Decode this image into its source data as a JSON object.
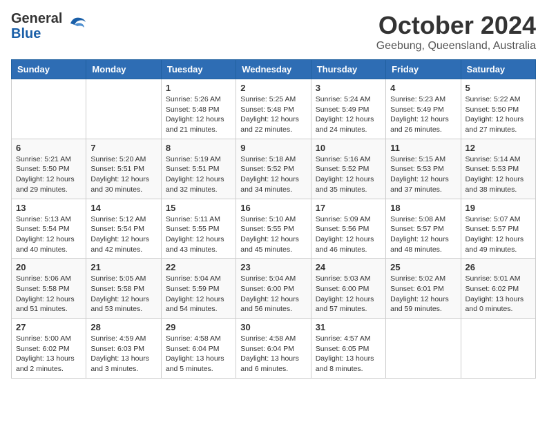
{
  "header": {
    "logo_general": "General",
    "logo_blue": "Blue",
    "month_title": "October 2024",
    "location": "Geebung, Queensland, Australia"
  },
  "weekdays": [
    "Sunday",
    "Monday",
    "Tuesday",
    "Wednesday",
    "Thursday",
    "Friday",
    "Saturday"
  ],
  "weeks": [
    [
      {
        "day": "",
        "info": ""
      },
      {
        "day": "",
        "info": ""
      },
      {
        "day": "1",
        "info": "Sunrise: 5:26 AM\nSunset: 5:48 PM\nDaylight: 12 hours and 21 minutes."
      },
      {
        "day": "2",
        "info": "Sunrise: 5:25 AM\nSunset: 5:48 PM\nDaylight: 12 hours and 22 minutes."
      },
      {
        "day": "3",
        "info": "Sunrise: 5:24 AM\nSunset: 5:49 PM\nDaylight: 12 hours and 24 minutes."
      },
      {
        "day": "4",
        "info": "Sunrise: 5:23 AM\nSunset: 5:49 PM\nDaylight: 12 hours and 26 minutes."
      },
      {
        "day": "5",
        "info": "Sunrise: 5:22 AM\nSunset: 5:50 PM\nDaylight: 12 hours and 27 minutes."
      }
    ],
    [
      {
        "day": "6",
        "info": "Sunrise: 5:21 AM\nSunset: 5:50 PM\nDaylight: 12 hours and 29 minutes."
      },
      {
        "day": "7",
        "info": "Sunrise: 5:20 AM\nSunset: 5:51 PM\nDaylight: 12 hours and 30 minutes."
      },
      {
        "day": "8",
        "info": "Sunrise: 5:19 AM\nSunset: 5:51 PM\nDaylight: 12 hours and 32 minutes."
      },
      {
        "day": "9",
        "info": "Sunrise: 5:18 AM\nSunset: 5:52 PM\nDaylight: 12 hours and 34 minutes."
      },
      {
        "day": "10",
        "info": "Sunrise: 5:16 AM\nSunset: 5:52 PM\nDaylight: 12 hours and 35 minutes."
      },
      {
        "day": "11",
        "info": "Sunrise: 5:15 AM\nSunset: 5:53 PM\nDaylight: 12 hours and 37 minutes."
      },
      {
        "day": "12",
        "info": "Sunrise: 5:14 AM\nSunset: 5:53 PM\nDaylight: 12 hours and 38 minutes."
      }
    ],
    [
      {
        "day": "13",
        "info": "Sunrise: 5:13 AM\nSunset: 5:54 PM\nDaylight: 12 hours and 40 minutes."
      },
      {
        "day": "14",
        "info": "Sunrise: 5:12 AM\nSunset: 5:54 PM\nDaylight: 12 hours and 42 minutes."
      },
      {
        "day": "15",
        "info": "Sunrise: 5:11 AM\nSunset: 5:55 PM\nDaylight: 12 hours and 43 minutes."
      },
      {
        "day": "16",
        "info": "Sunrise: 5:10 AM\nSunset: 5:55 PM\nDaylight: 12 hours and 45 minutes."
      },
      {
        "day": "17",
        "info": "Sunrise: 5:09 AM\nSunset: 5:56 PM\nDaylight: 12 hours and 46 minutes."
      },
      {
        "day": "18",
        "info": "Sunrise: 5:08 AM\nSunset: 5:57 PM\nDaylight: 12 hours and 48 minutes."
      },
      {
        "day": "19",
        "info": "Sunrise: 5:07 AM\nSunset: 5:57 PM\nDaylight: 12 hours and 49 minutes."
      }
    ],
    [
      {
        "day": "20",
        "info": "Sunrise: 5:06 AM\nSunset: 5:58 PM\nDaylight: 12 hours and 51 minutes."
      },
      {
        "day": "21",
        "info": "Sunrise: 5:05 AM\nSunset: 5:58 PM\nDaylight: 12 hours and 53 minutes."
      },
      {
        "day": "22",
        "info": "Sunrise: 5:04 AM\nSunset: 5:59 PM\nDaylight: 12 hours and 54 minutes."
      },
      {
        "day": "23",
        "info": "Sunrise: 5:04 AM\nSunset: 6:00 PM\nDaylight: 12 hours and 56 minutes."
      },
      {
        "day": "24",
        "info": "Sunrise: 5:03 AM\nSunset: 6:00 PM\nDaylight: 12 hours and 57 minutes."
      },
      {
        "day": "25",
        "info": "Sunrise: 5:02 AM\nSunset: 6:01 PM\nDaylight: 12 hours and 59 minutes."
      },
      {
        "day": "26",
        "info": "Sunrise: 5:01 AM\nSunset: 6:02 PM\nDaylight: 13 hours and 0 minutes."
      }
    ],
    [
      {
        "day": "27",
        "info": "Sunrise: 5:00 AM\nSunset: 6:02 PM\nDaylight: 13 hours and 2 minutes."
      },
      {
        "day": "28",
        "info": "Sunrise: 4:59 AM\nSunset: 6:03 PM\nDaylight: 13 hours and 3 minutes."
      },
      {
        "day": "29",
        "info": "Sunrise: 4:58 AM\nSunset: 6:04 PM\nDaylight: 13 hours and 5 minutes."
      },
      {
        "day": "30",
        "info": "Sunrise: 4:58 AM\nSunset: 6:04 PM\nDaylight: 13 hours and 6 minutes."
      },
      {
        "day": "31",
        "info": "Sunrise: 4:57 AM\nSunset: 6:05 PM\nDaylight: 13 hours and 8 minutes."
      },
      {
        "day": "",
        "info": ""
      },
      {
        "day": "",
        "info": ""
      }
    ]
  ]
}
